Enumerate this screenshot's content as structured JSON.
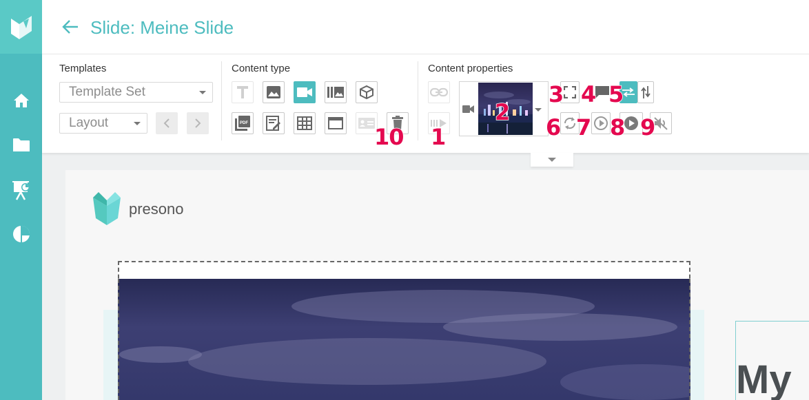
{
  "header": {
    "title": "Slide: Meine Slide"
  },
  "sidebar": {
    "items": [
      {
        "name": "home",
        "icon": "home-icon"
      },
      {
        "name": "folders",
        "icon": "folder-icon"
      },
      {
        "name": "presentations",
        "icon": "presentation-icon"
      },
      {
        "name": "statistics",
        "icon": "pie-chart-icon"
      }
    ]
  },
  "toolbar": {
    "templates": {
      "label": "Templates",
      "template_set": "Template Set",
      "layout": "Layout"
    },
    "content_type": {
      "label": "Content type"
    },
    "content_properties": {
      "label": "Content properties"
    }
  },
  "annotations": [
    "1",
    "2",
    "3",
    "4",
    "5",
    "6",
    "7",
    "8",
    "9",
    "10"
  ],
  "slide": {
    "brand": "presono",
    "heading": "My"
  },
  "colors": {
    "accent": "#4dbcbf",
    "annotation": "#e4094f"
  }
}
